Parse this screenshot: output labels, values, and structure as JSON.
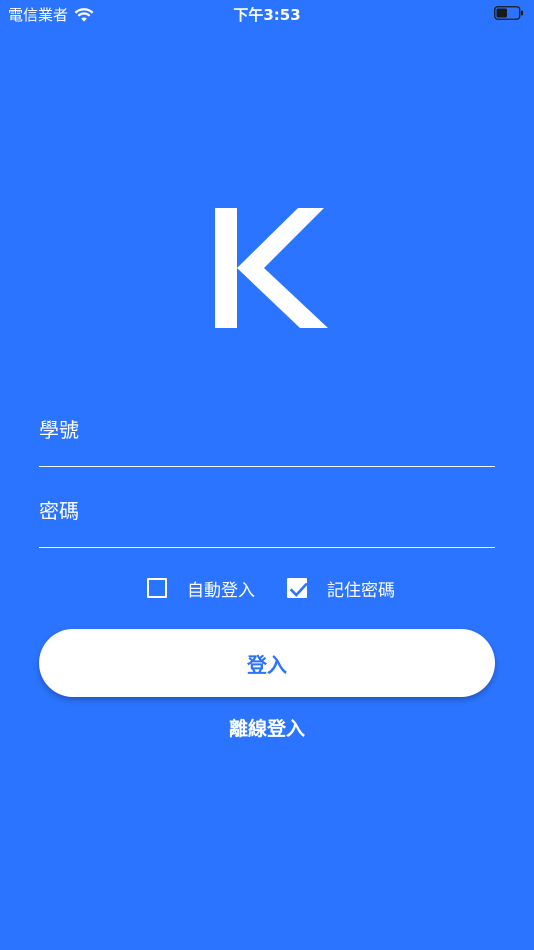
{
  "status_bar": {
    "carrier": "電信業者",
    "time": "下午3:53"
  },
  "login_form": {
    "username_label": "學號",
    "username_value": "",
    "password_label": "密碼",
    "password_value": ""
  },
  "options": {
    "auto_login_label": "自動登入",
    "auto_login_checked": false,
    "remember_password_label": "記住密碼",
    "remember_password_checked": true
  },
  "actions": {
    "login_label": "登入",
    "offline_login_label": "離線登入"
  },
  "colors": {
    "background": "#2b74ff",
    "button_bg": "#ffffff",
    "button_text": "#2b74ff"
  }
}
